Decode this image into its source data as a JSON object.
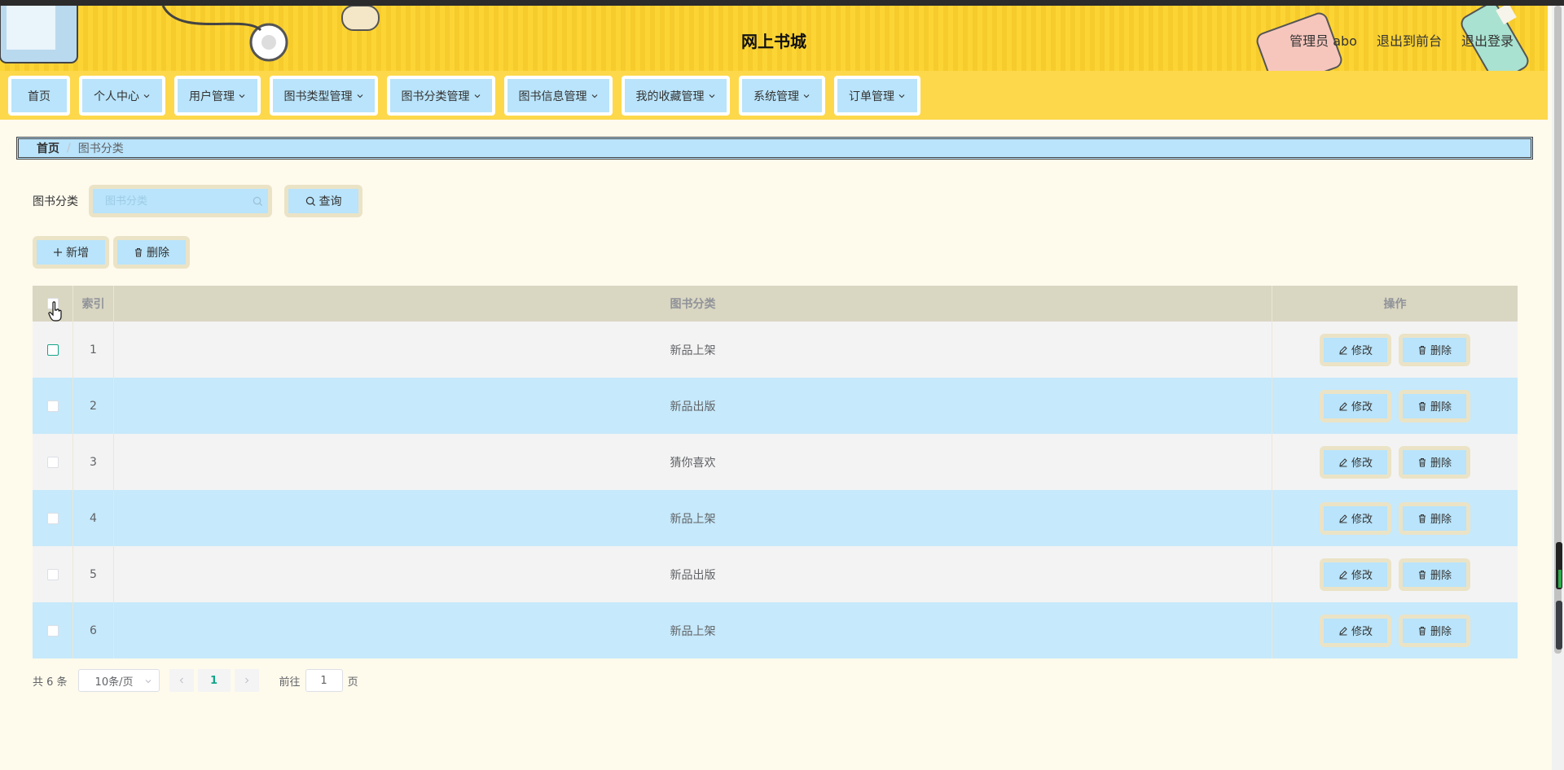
{
  "header": {
    "title": "网上书城",
    "links": [
      "管理员 abo",
      "退出到前台",
      "退出登录"
    ]
  },
  "nav": {
    "items": [
      {
        "label": "首页",
        "dropdown": false,
        "width": 76
      },
      {
        "label": "个人中心",
        "dropdown": true,
        "width": 106
      },
      {
        "label": "用户管理",
        "dropdown": true,
        "width": 106
      },
      {
        "label": "图书类型管理",
        "dropdown": true,
        "width": 133
      },
      {
        "label": "图书分类管理",
        "dropdown": true,
        "width": 133
      },
      {
        "label": "图书信息管理",
        "dropdown": true,
        "width": 133
      },
      {
        "label": "我的收藏管理",
        "dropdown": true,
        "width": 133
      },
      {
        "label": "系统管理",
        "dropdown": true,
        "width": 106
      },
      {
        "label": "订单管理",
        "dropdown": true,
        "width": 106
      }
    ]
  },
  "breadcrumb": {
    "home": "首页",
    "separator": "/",
    "current": "图书分类"
  },
  "search": {
    "label": "图书分类",
    "placeholder": "图书分类",
    "value": "",
    "button": "查询"
  },
  "actions": {
    "add": "新增",
    "delete": "删除"
  },
  "table": {
    "headers": {
      "index": "索引",
      "category": "图书分类",
      "ops": "操作"
    },
    "rows": [
      {
        "index": "1",
        "category": "新品上架"
      },
      {
        "index": "2",
        "category": "新品出版"
      },
      {
        "index": "3",
        "category": "猜你喜欢"
      },
      {
        "index": "4",
        "category": "新品上架"
      },
      {
        "index": "5",
        "category": "新品出版"
      },
      {
        "index": "6",
        "category": "新品上架"
      }
    ],
    "edit_label": "修改",
    "delete_label": "删除"
  },
  "pagination": {
    "total": "共 6 条",
    "page_size": "10条/页",
    "current_page": "1",
    "goto_label": "前往",
    "goto_value": "1",
    "page_suffix": "页"
  },
  "colors": {
    "header_yellow": "#fcd535",
    "nav_yellow": "#fdd84b",
    "button_blue": "#b9e4fb",
    "row_blue": "#c6e9fb",
    "accent_green": "#13a689",
    "page_bg": "#fefaec"
  }
}
